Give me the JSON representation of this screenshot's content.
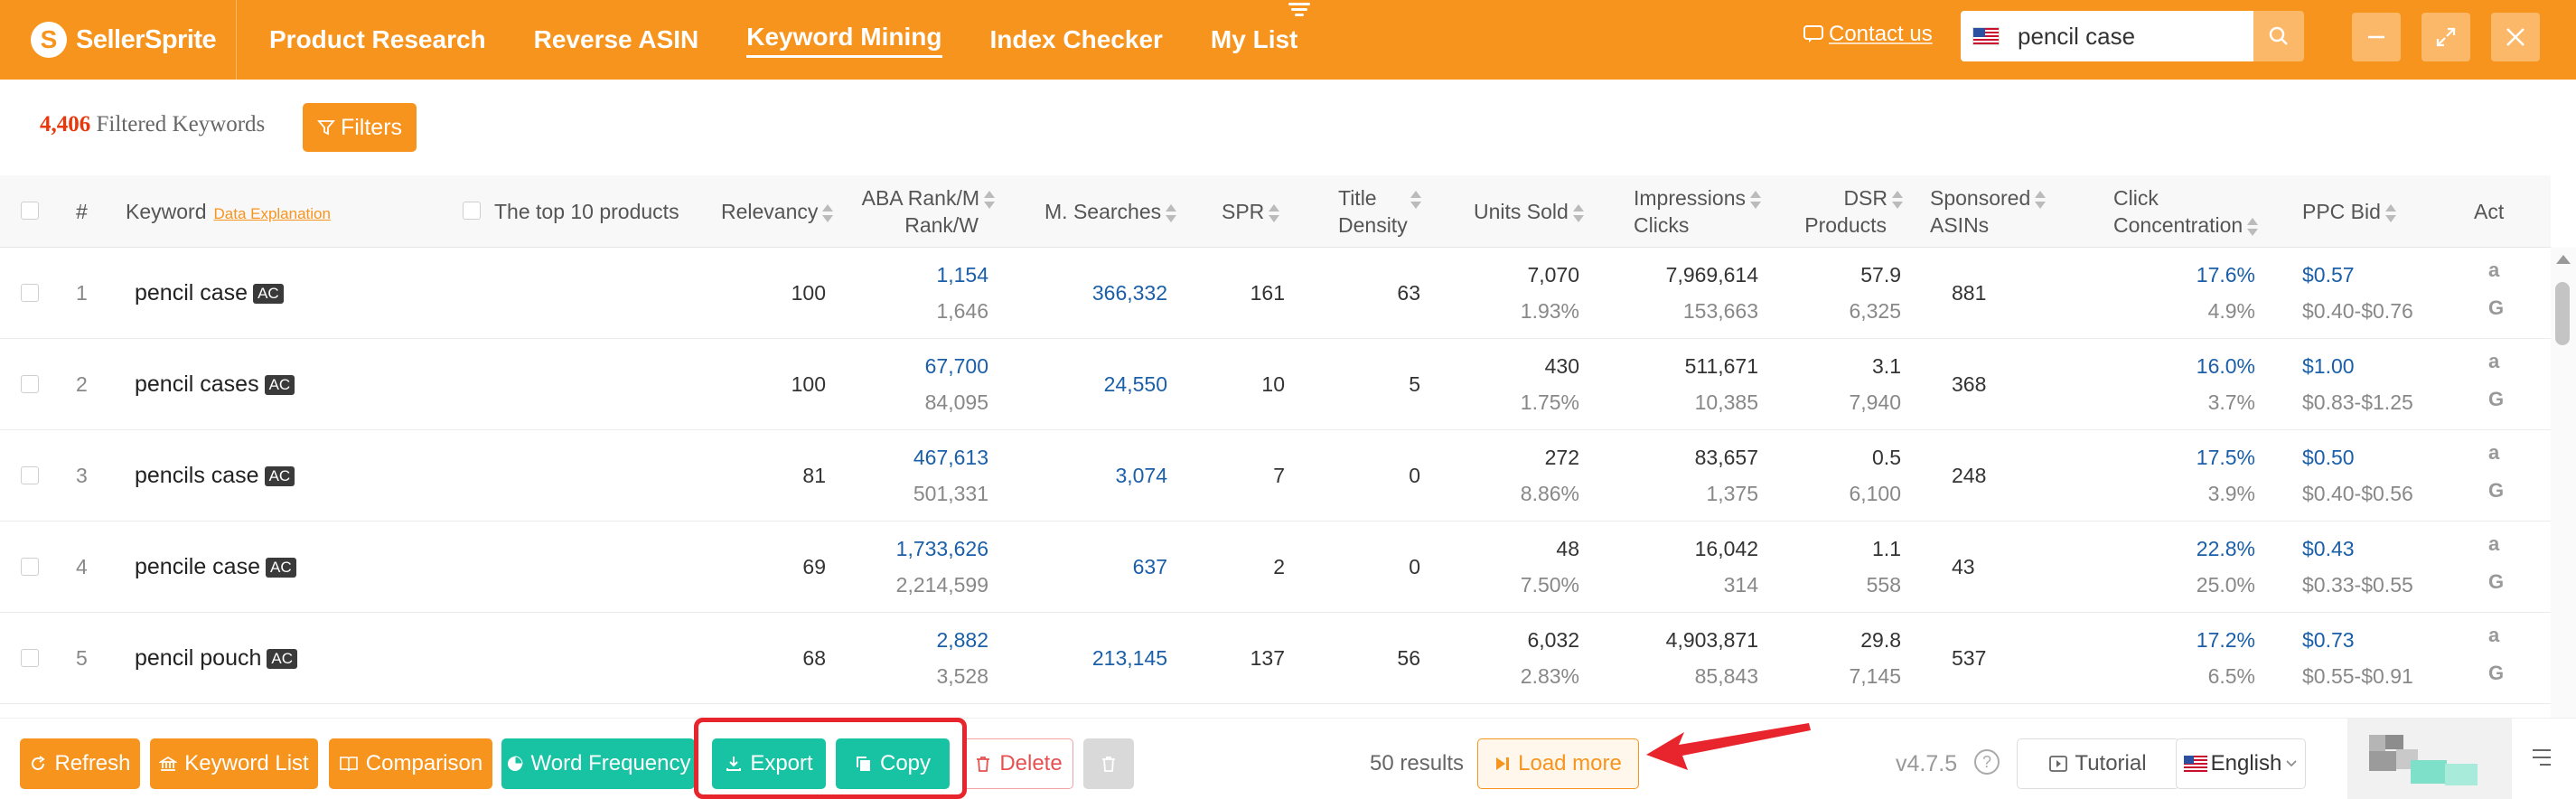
{
  "brand": {
    "name": "SellerSprite"
  },
  "nav": [
    {
      "label": "Product Research",
      "active": false
    },
    {
      "label": "Reverse ASIN",
      "active": false
    },
    {
      "label": "Keyword Mining",
      "active": true
    },
    {
      "label": "Index Checker",
      "active": false
    },
    {
      "label": "My List",
      "active": false
    }
  ],
  "header": {
    "contact_label": "Contact us",
    "search_value": "pencil case",
    "marketplace": "US"
  },
  "filterbar": {
    "count": "4,406",
    "count_label": "Filtered Keywords",
    "filters_label": "Filters"
  },
  "table": {
    "headers": {
      "index": "#",
      "keyword": "Keyword",
      "data_explanation": "Data Explanation",
      "top10": "The top 10 products",
      "relevancy": "Relevancy",
      "aba_line1": "ABA Rank/M",
      "aba_line2": "Rank/W",
      "msearches": "M. Searches",
      "spr": "SPR",
      "title_line1": "Title",
      "title_line2": "Density",
      "units_sold": "Units Sold",
      "impressions_line1": "Impressions",
      "impressions_line2": "Clicks",
      "dsr_line1": "DSR",
      "dsr_line2": "Products",
      "sponsored_line1": "Sponsored",
      "sponsored_line2": "ASINs",
      "click_line1": "Click",
      "click_line2": "Concentration",
      "ppc": "PPC Bid",
      "act": "Act"
    },
    "ac_badge": "AC",
    "rows": [
      {
        "index": "1",
        "keyword": "pencil case",
        "relevancy": "100",
        "aba_m": "1,154",
        "aba_w": "1,646",
        "searches": "366,332",
        "spr": "161",
        "title_density": "63",
        "units": "7,070",
        "units_pct": "1.93%",
        "impressions": "7,969,614",
        "clicks": "153,663",
        "dsr": "57.9",
        "products": "6,325",
        "sponsored": "881",
        "click_conc": "17.6%",
        "click_sub": "4.9%",
        "ppc": "$0.57",
        "ppc_range": "$0.40-$0.76"
      },
      {
        "index": "2",
        "keyword": "pencil cases",
        "relevancy": "100",
        "aba_m": "67,700",
        "aba_w": "84,095",
        "searches": "24,550",
        "spr": "10",
        "title_density": "5",
        "units": "430",
        "units_pct": "1.75%",
        "impressions": "511,671",
        "clicks": "10,385",
        "dsr": "3.1",
        "products": "7,940",
        "sponsored": "368",
        "click_conc": "16.0%",
        "click_sub": "3.7%",
        "ppc": "$1.00",
        "ppc_range": "$0.83-$1.25"
      },
      {
        "index": "3",
        "keyword": "pencils case",
        "relevancy": "81",
        "aba_m": "467,613",
        "aba_w": "501,331",
        "searches": "3,074",
        "spr": "7",
        "title_density": "0",
        "units": "272",
        "units_pct": "8.86%",
        "impressions": "83,657",
        "clicks": "1,375",
        "dsr": "0.5",
        "products": "6,100",
        "sponsored": "248",
        "click_conc": "17.5%",
        "click_sub": "3.9%",
        "ppc": "$0.50",
        "ppc_range": "$0.40-$0.56"
      },
      {
        "index": "4",
        "keyword": "pencile case",
        "relevancy": "69",
        "aba_m": "1,733,626",
        "aba_w": "2,214,599",
        "searches": "637",
        "spr": "2",
        "title_density": "0",
        "units": "48",
        "units_pct": "7.50%",
        "impressions": "16,042",
        "clicks": "314",
        "dsr": "1.1",
        "products": "558",
        "sponsored": "43",
        "click_conc": "22.8%",
        "click_sub": "25.0%",
        "ppc": "$0.43",
        "ppc_range": "$0.33-$0.55"
      },
      {
        "index": "5",
        "keyword": "pencil pouch",
        "relevancy": "68",
        "aba_m": "2,882",
        "aba_w": "3,528",
        "searches": "213,145",
        "spr": "137",
        "title_density": "56",
        "units": "6,032",
        "units_pct": "2.83%",
        "impressions": "4,903,871",
        "clicks": "85,843",
        "dsr": "29.8",
        "products": "7,145",
        "sponsored": "537",
        "click_conc": "17.2%",
        "click_sub": "6.5%",
        "ppc": "$0.73",
        "ppc_range": "$0.55-$0.91"
      }
    ]
  },
  "footer": {
    "refresh": "Refresh",
    "keyword_list": "Keyword List",
    "comparison": "Comparison",
    "word_frequency": "Word Frequency",
    "export": "Export",
    "copy": "Copy",
    "delete": "Delete",
    "results": "50 results",
    "load_more": "Load more",
    "version": "v4.7.5",
    "help": "?",
    "tutorial": "Tutorial",
    "language": "English"
  },
  "colors": {
    "brand_orange": "#f7941d",
    "teal": "#17c3a2",
    "link_blue": "#1a5fa8",
    "annotation_red": "#e8242c"
  }
}
